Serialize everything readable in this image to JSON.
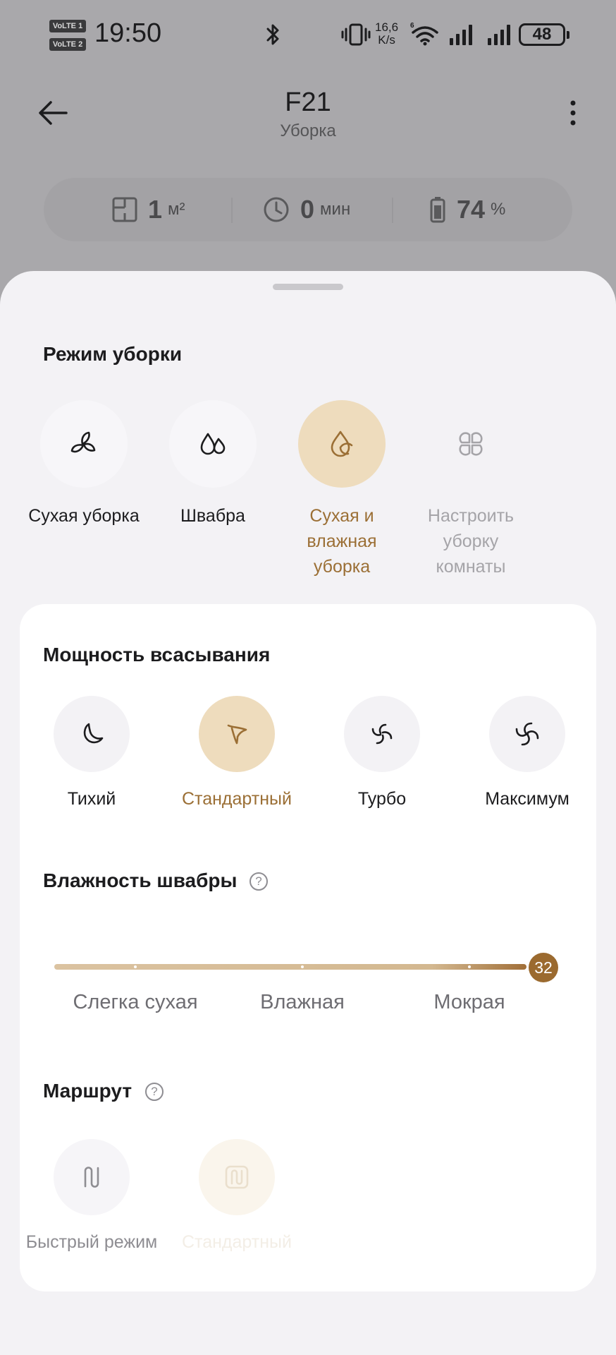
{
  "status_bar": {
    "volte1": "VoLTE 1",
    "volte2": "VoLTE 2",
    "time": "19:50",
    "net_speed_value": "16,6",
    "net_speed_unit": "K/s",
    "battery": "48"
  },
  "header": {
    "title": "F21",
    "subtitle": "Уборка"
  },
  "stats": {
    "area_value": "1",
    "area_unit": "м²",
    "time_value": "0",
    "time_unit": "мин",
    "battery_value": "74",
    "battery_unit": "%"
  },
  "cleaning_mode": {
    "title": "Режим уборки",
    "options": [
      {
        "label": "Сухая уборка",
        "icon": "fan-icon",
        "state": "normal"
      },
      {
        "label": "Швабра",
        "icon": "water-drops-icon",
        "state": "normal"
      },
      {
        "label": "Сухая и влажная уборка",
        "icon": "drop-fan-icon",
        "state": "selected"
      },
      {
        "label": "Настроить уборку комнаты",
        "icon": "rooms-grid-icon",
        "state": "disabled"
      }
    ]
  },
  "suction_power": {
    "title": "Мощность всасывания",
    "options": [
      {
        "label": "Тихий",
        "icon": "quiet-fan-icon",
        "state": "normal"
      },
      {
        "label": "Стандартный",
        "icon": "standard-fan-icon",
        "state": "selected"
      },
      {
        "label": "Турбо",
        "icon": "turbo-fan-icon",
        "state": "normal"
      },
      {
        "label": "Максимум",
        "icon": "max-fan-icon",
        "state": "normal"
      }
    ]
  },
  "mop_humidity": {
    "title": "Влажность швабры",
    "help": "?",
    "value": "32",
    "level_fraction": 1.0,
    "labels": [
      "Слегка сухая",
      "Влажная",
      "Мокрая"
    ]
  },
  "route": {
    "title": "Маршрут",
    "help": "?",
    "options": [
      {
        "label": "Быстрый режим",
        "icon": "quick-route-icon",
        "state": "dim"
      },
      {
        "label": "Стандартный",
        "icon": "standard-route-icon",
        "state": "faded"
      }
    ]
  },
  "colors": {
    "accent": "#9b6f35",
    "accent_bg": "#eedcbd",
    "sheet_bg": "#f3f2f5",
    "overlay": "#a9a8ab"
  }
}
